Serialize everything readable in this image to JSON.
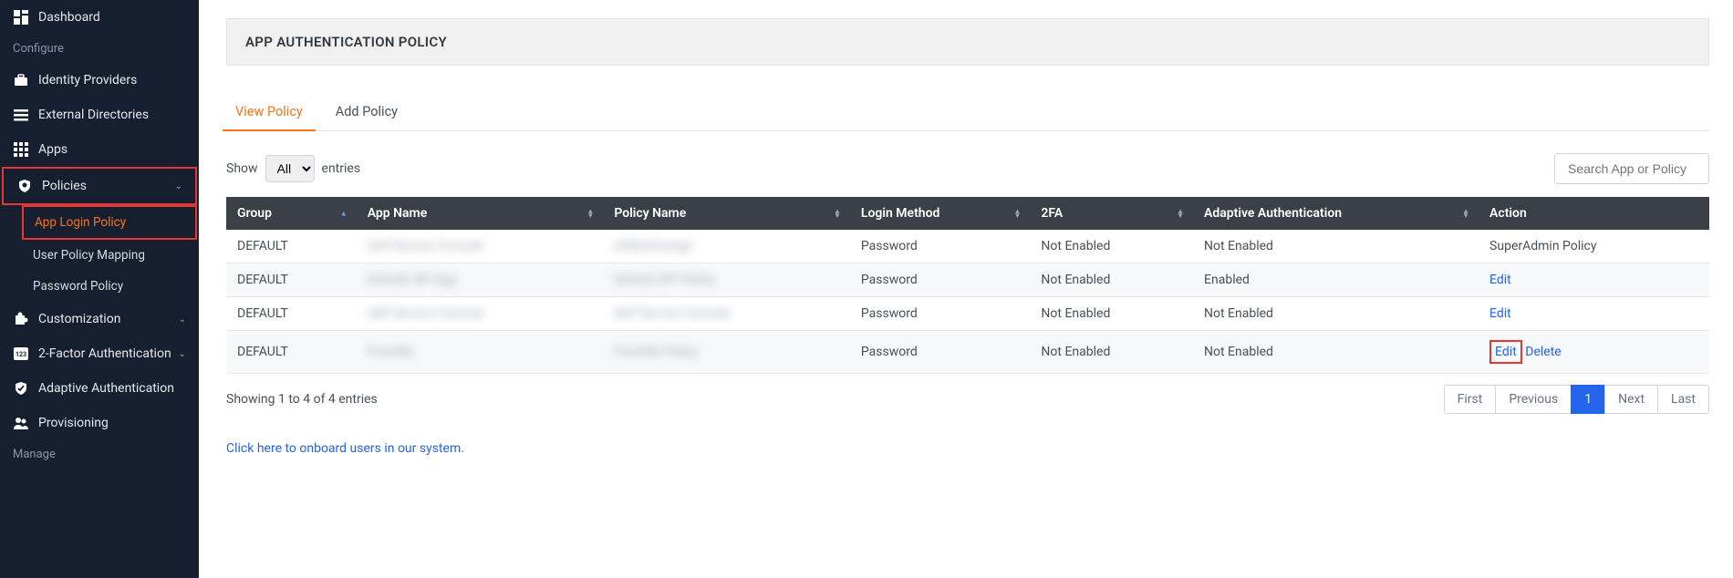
{
  "sidebar": {
    "dashboard": "Dashboard",
    "configure": "Configure",
    "identity_providers": "Identity Providers",
    "external_directories": "External Directories",
    "apps": "Apps",
    "policies": "Policies",
    "app_login_policy": "App Login Policy",
    "user_policy_mapping": "User Policy Mapping",
    "password_policy": "Password Policy",
    "customization": "Customization",
    "two_factor": "2-Factor Authentication",
    "adaptive_auth": "Adaptive Authentication",
    "provisioning": "Provisioning",
    "manage": "Manage"
  },
  "page": {
    "title": "APP AUTHENTICATION POLICY"
  },
  "tabs": {
    "view": "View Policy",
    "add": "Add Policy"
  },
  "entries": {
    "show": "Show",
    "label": "entries",
    "options": [
      "All"
    ],
    "selected": "All"
  },
  "search": {
    "placeholder": "Search App or Policy"
  },
  "columns": {
    "group": "Group",
    "app_name": "App Name",
    "policy_name": "Policy Name",
    "login_method": "Login Method",
    "two_fa": "2FA",
    "adaptive": "Adaptive Authentication",
    "action": "Action"
  },
  "rows": [
    {
      "group": "DEFAULT",
      "app_name": "Self Service Console",
      "policy_name": "x0MiniOrange",
      "login_method": "Password",
      "two_fa": "Not Enabled",
      "adaptive": "Not Enabled",
      "action_type": "super"
    },
    {
      "group": "DEFAULT",
      "app_name": "Default API App",
      "policy_name": "Default API Policy",
      "login_method": "Password",
      "two_fa": "Not Enabled",
      "adaptive": "Enabled",
      "action_type": "edit"
    },
    {
      "group": "DEFAULT",
      "app_name": "Self Service Console",
      "policy_name": "Self Service Console",
      "login_method": "Password",
      "two_fa": "Not Enabled",
      "adaptive": "Not Enabled",
      "action_type": "edit"
    },
    {
      "group": "DEFAULT",
      "app_name": "Formilla",
      "policy_name": "Formilla Policy",
      "login_method": "Password",
      "two_fa": "Not Enabled",
      "adaptive": "Not Enabled",
      "action_type": "edit_delete"
    }
  ],
  "actions": {
    "super": "SuperAdmin Policy",
    "edit": "Edit",
    "delete": "Delete"
  },
  "footer": {
    "showing": "Showing 1 to 4 of 4 entries",
    "first": "First",
    "previous": "Previous",
    "page": "1",
    "next": "Next",
    "last": "Last"
  },
  "onboard": "Click here to onboard users in our system."
}
